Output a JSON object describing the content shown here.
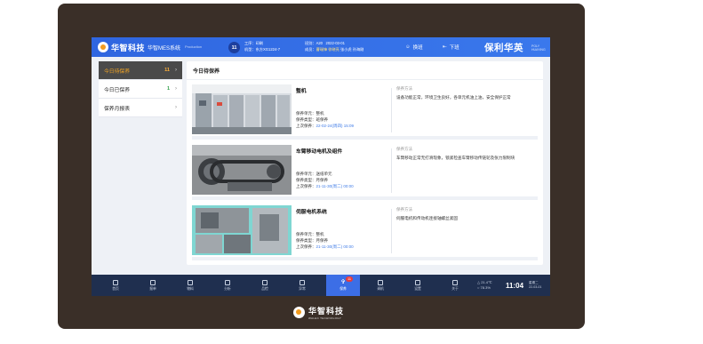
{
  "header": {
    "logo_text": "华智科技",
    "system_name": "华智MES系统",
    "system_sub": "Production",
    "shift_number": "11",
    "process_label": "工序：印刷",
    "machine_label": "机型：东方XG1224-7",
    "team_label": "班别：A20",
    "date": "2022-03-01",
    "members_prefix": "成员：",
    "members_highlight": "曹瑞锋 徐晓亮",
    "members_rest": "张小虎 孙海刚",
    "handover_label": "换班",
    "logout_label": "下班",
    "brand_right": "保利华英",
    "brand_right_sub_1": "POLY",
    "brand_right_sub_2": "HUAYING"
  },
  "sidebar": {
    "items": [
      {
        "label": "今日待保养",
        "count": "11",
        "active": true
      },
      {
        "label": "今日已保养",
        "count": "1",
        "active": false
      },
      {
        "label": "保养月报表",
        "count": "",
        "active": false
      }
    ]
  },
  "main": {
    "title": "今日待保养",
    "method_label": "保养方法",
    "cards": [
      {
        "name": "整机",
        "unit": "保养单元：整机",
        "type": "保养类型：班保养",
        "last_prefix": "上次保养：",
        "last_date": "22-02-24(周四) 15:09",
        "method": "设备功能正常，环境卫生良好，各单元机油上油，安全保护正常"
      },
      {
        "name": "车臂移动电机及组件",
        "unit": "保养单元：送纸单元",
        "type": "保养类型：月保养",
        "last_prefix": "上次保养：",
        "last_date": "21-11-30(周二) 00:00",
        "method": "车臂移动正常无打滑现象，锁紧检查车臂移动传链轮及张力限制块"
      },
      {
        "name": "伺服电机系统",
        "unit": "保养单元：整机",
        "type": "保养类型：月保养",
        "last_prefix": "上次保养：",
        "last_date": "21-11-30(周二) 00:00",
        "method": "伺服电机和传动机连接轴螺丝紧固"
      }
    ]
  },
  "bottombar": {
    "nav": [
      {
        "label": "首页",
        "icon": "home-icon"
      },
      {
        "label": "报单",
        "icon": "document-icon"
      },
      {
        "label": "物料",
        "icon": "layers-icon"
      },
      {
        "label": "分析",
        "icon": "chart-icon"
      },
      {
        "label": "品检",
        "icon": "shield-icon"
      },
      {
        "label": "异常",
        "icon": "alert-icon"
      },
      {
        "label": "保养",
        "icon": "wrench-icon",
        "badge": "11",
        "active": true
      },
      {
        "label": "调机",
        "icon": "sliders-icon"
      },
      {
        "label": "设置",
        "icon": "gear-icon"
      },
      {
        "label": "关于",
        "icon": "info-icon"
      }
    ],
    "temperature": "21.4℃",
    "humidity": "78.3%",
    "time": "11:04",
    "weekday": "星期二",
    "date": "22-03-01"
  },
  "footer": {
    "logo_text": "华智科技",
    "logo_en": "WALEC TECHNOLOGY"
  }
}
